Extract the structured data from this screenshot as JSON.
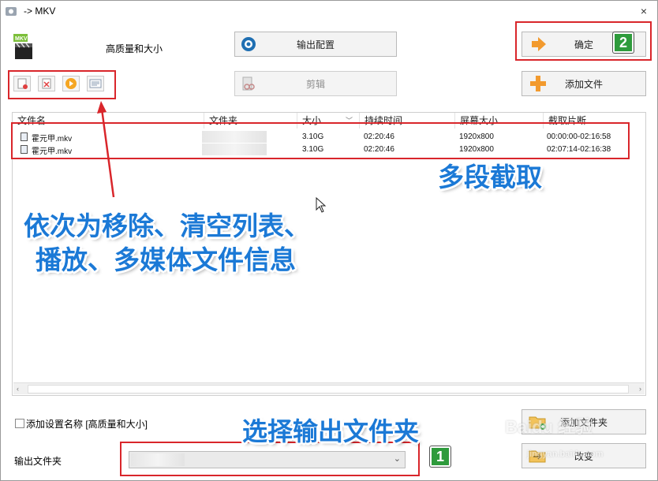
{
  "window": {
    "title": "-> MKV",
    "close_glyph": "×"
  },
  "header": {
    "profile_label": "高质量和大小",
    "output_config_label": "输出配置",
    "edit_label": "剪辑",
    "ok_label": "确定",
    "add_file_label": "添加文件"
  },
  "toolbar": {
    "icons": [
      "remove-icon",
      "clear-list-icon",
      "play-icon",
      "media-info-icon"
    ]
  },
  "file_list": {
    "columns": [
      "文件名",
      "文件夹",
      "大小",
      "持续时间",
      "屏幕大小",
      "截取片断"
    ],
    "rows": [
      {
        "name": "霍元甲.mkv",
        "folder": "",
        "size": "3.10G",
        "duration": "02:20:46",
        "screen": "1920x800",
        "clip": "00:00:00-02:16:58"
      },
      {
        "name": "霍元甲.mkv",
        "folder": "",
        "size": "3.10G",
        "duration": "02:20:46",
        "screen": "1920x800",
        "clip": "02:07:14-02:16:38"
      }
    ]
  },
  "bottom": {
    "add_setting_name_label": "添加设置名称 [高质量和大小]",
    "output_folder_label": "输出文件夹",
    "output_folder_value": "",
    "add_folder_label": "添加文件夹",
    "change_label": "改变"
  },
  "annotations": {
    "callout_toolbar_line1": "依次为移除、清空列表、",
    "callout_toolbar_line2": "播放、多媒体文件信息",
    "callout_multi": "多段截取",
    "callout_output": "选择输出文件夹",
    "badge_1": "1",
    "badge_2": "2",
    "accent_red": "#d9262b",
    "accent_blue": "#1b79d6",
    "badge_green": "#2e9b3c"
  },
  "watermark": {
    "line1": "Baidu 经验",
    "line2": "jingyan.baidu.com"
  }
}
